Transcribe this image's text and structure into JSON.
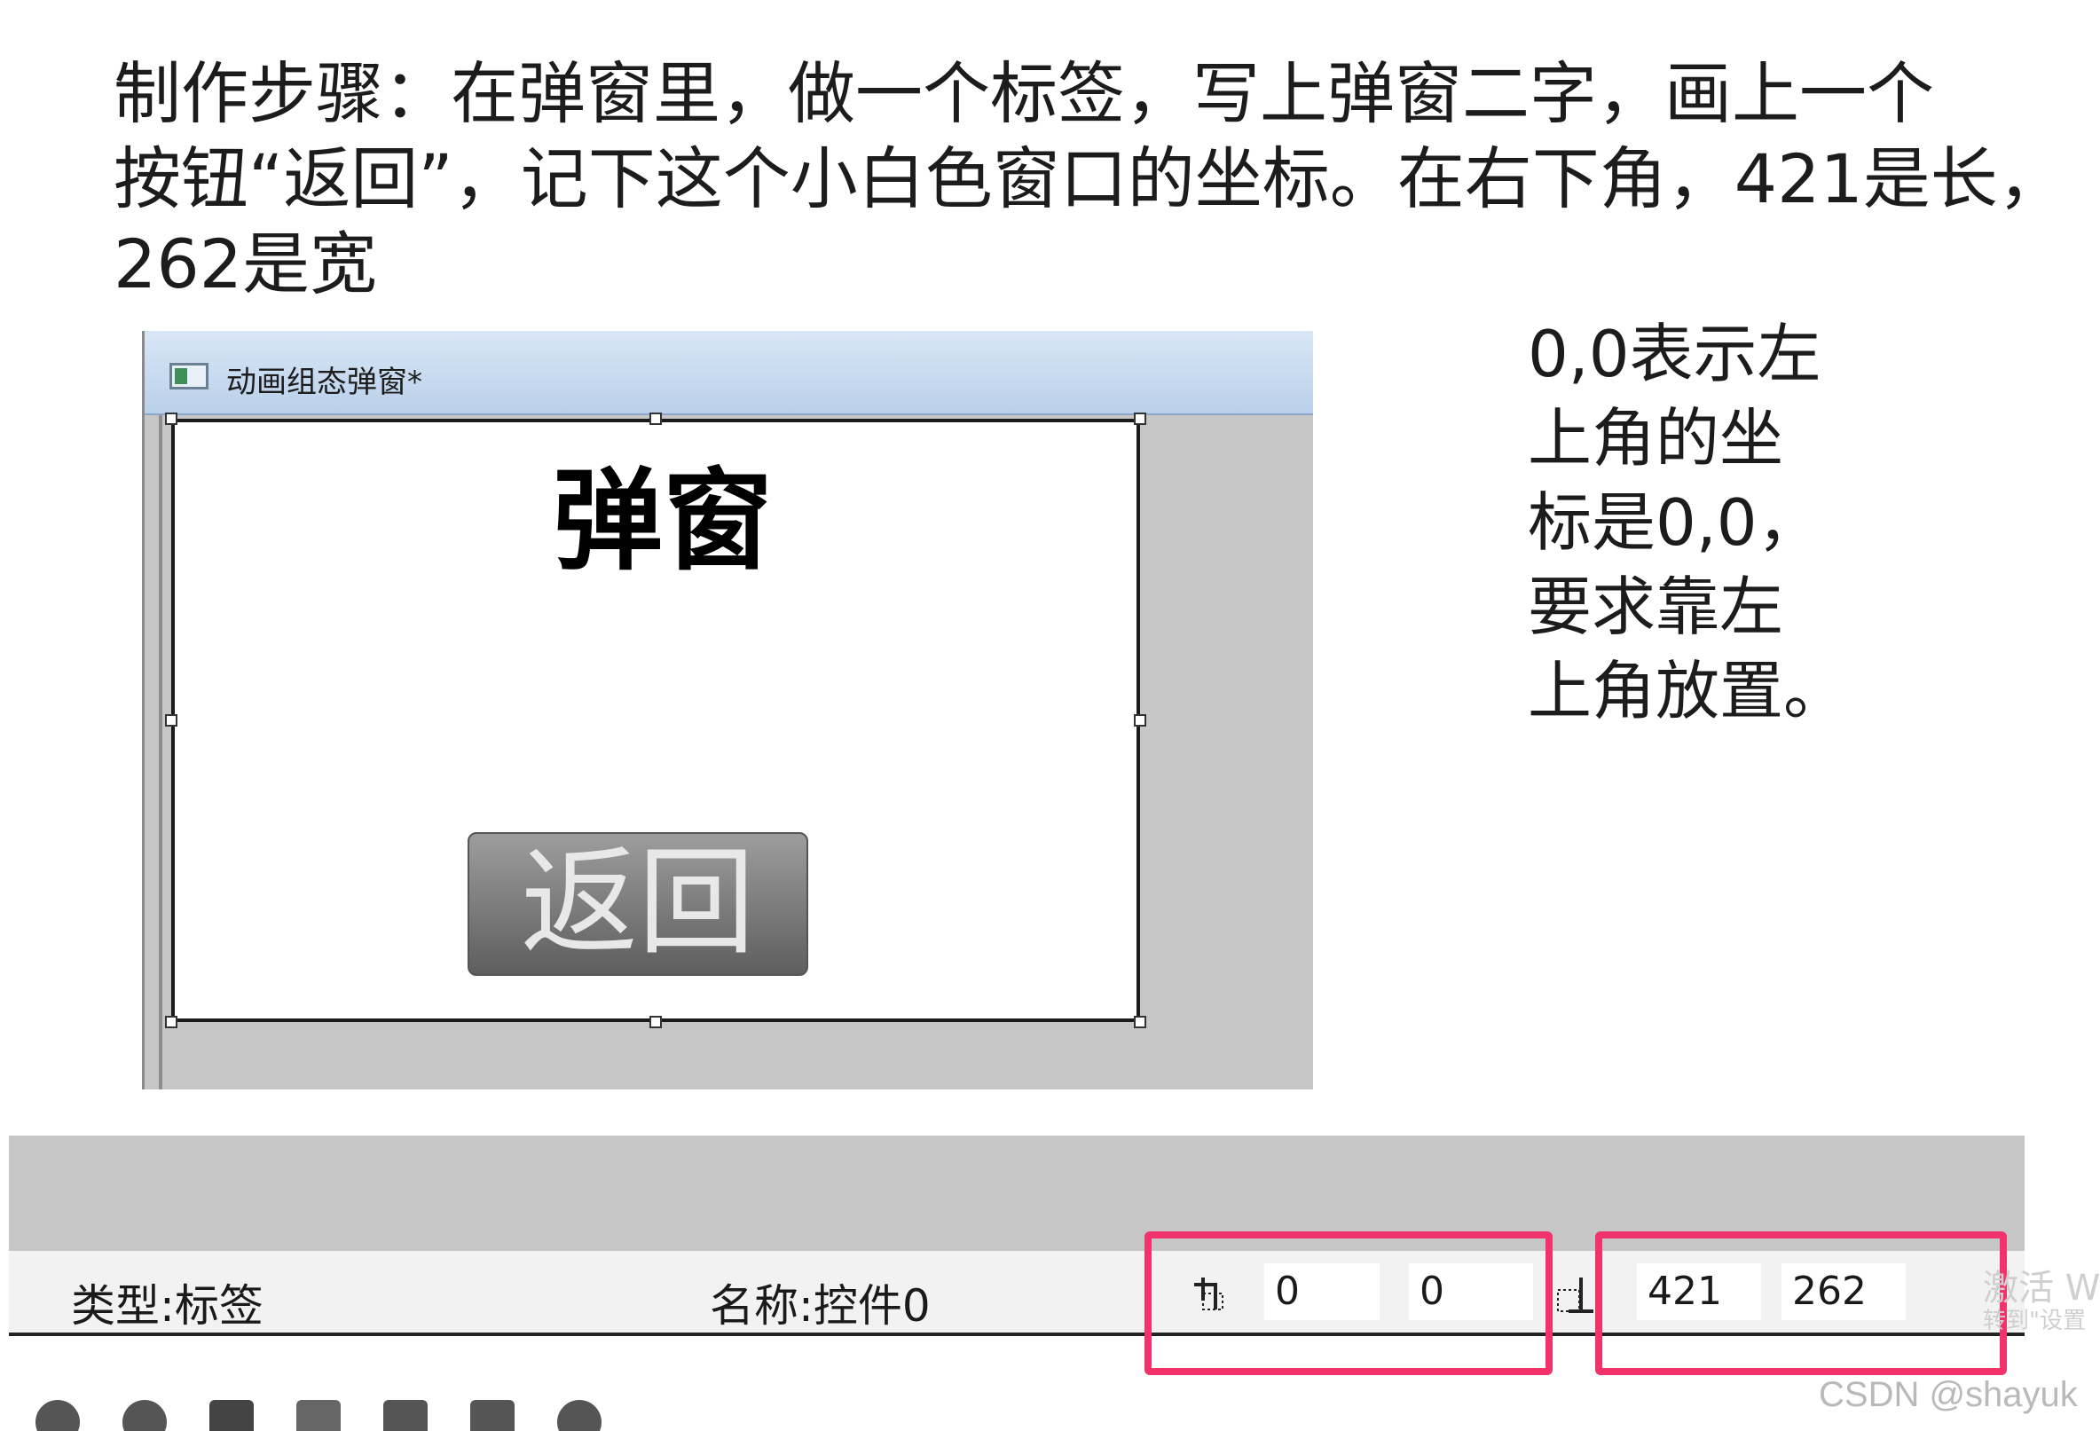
{
  "intro": {
    "line1": "制作步骤：在弹窗里，做一个标签，写上弹窗二字，画上一个",
    "line2": "按钮“返回”，记下这个小白色窗口的坐标。在右下角，421是长，",
    "line3": "262是宽"
  },
  "note": {
    "line1": "0,0表示左",
    "line2": "上角的坐",
    "line3": "标是0,0，",
    "line4": "要求靠左",
    "line5": "上角放置。"
  },
  "designer": {
    "window_title": "动画组态弹窗*",
    "popup": {
      "label_text": "弹窗",
      "button_text": "返回"
    }
  },
  "statusbar": {
    "type_text": "类型:标签",
    "name_text": "名称:控件0",
    "pos_x": "0",
    "pos_y": "0",
    "width": "421",
    "height": "262"
  },
  "watermark": {
    "activate_line1": "激活 W",
    "activate_line2": "转到\"设置",
    "csdn": "CSDN @shayuk"
  },
  "colors": {
    "highlight": "#f0336b"
  }
}
